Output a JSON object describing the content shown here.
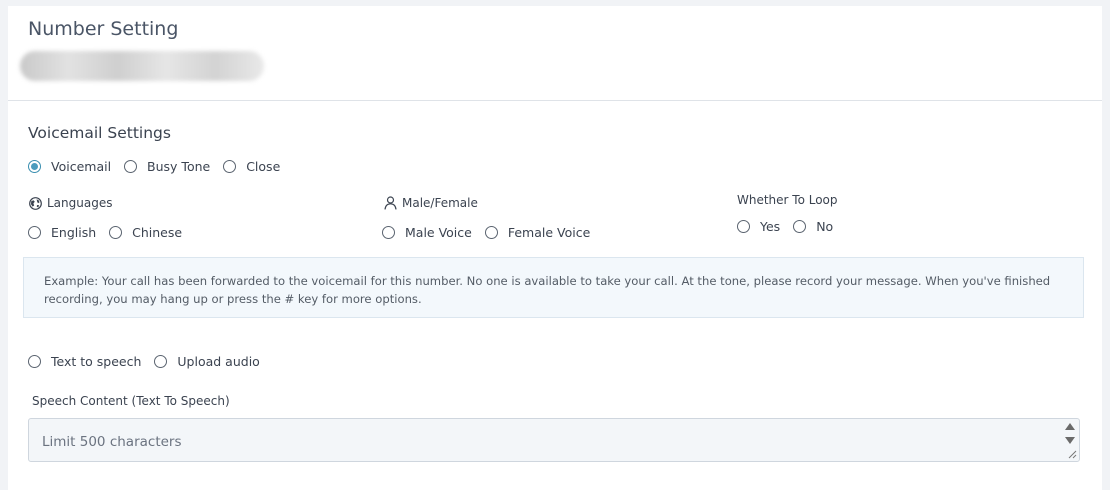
{
  "header": {
    "title": "Number Setting"
  },
  "voicemail": {
    "section_title": "Voicemail Settings",
    "mode_options": [
      {
        "label": "Voicemail",
        "checked": true
      },
      {
        "label": "Busy Tone",
        "checked": false
      },
      {
        "label": "Close",
        "checked": false
      }
    ],
    "languages": {
      "label": "Languages",
      "options": [
        {
          "label": "English",
          "checked": false
        },
        {
          "label": "Chinese",
          "checked": false
        }
      ]
    },
    "gender": {
      "label": "Male/Female",
      "options": [
        {
          "label": "Male Voice",
          "checked": false
        },
        {
          "label": "Female Voice",
          "checked": false
        }
      ]
    },
    "loop": {
      "label": "Whether To Loop",
      "options": [
        {
          "label": "Yes",
          "checked": false
        },
        {
          "label": "No",
          "checked": false
        }
      ]
    },
    "example_text": "Example: Your call has been forwarded to the voicemail for this number. No one is available to take your call. At the tone, please record your message. When you've finished recording, you may hang up or press the # key for more options.",
    "source_options": [
      {
        "label": "Text to speech",
        "checked": false
      },
      {
        "label": "Upload audio",
        "checked": false
      }
    ],
    "speech_label": "Speech Content (Text To Speech)",
    "speech_placeholder": "Limit 500 characters"
  },
  "colors": {
    "accent": "#4a9bbd"
  },
  "icons": {
    "languages": "globe-icon",
    "gender": "person-icon"
  }
}
